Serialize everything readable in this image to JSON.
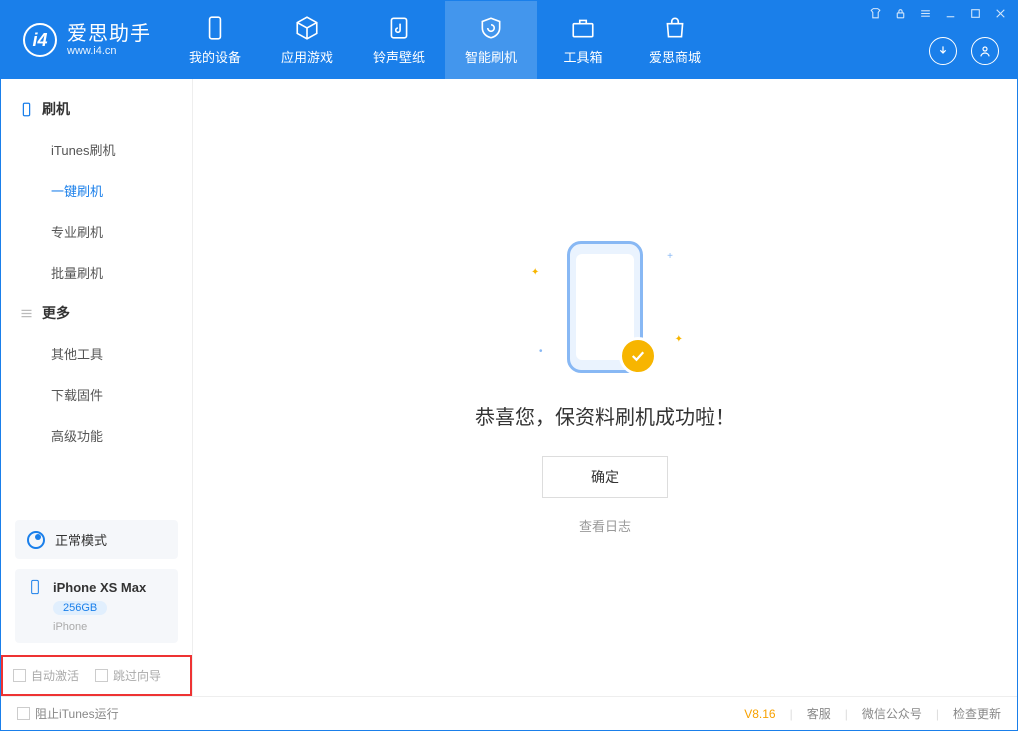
{
  "brand": {
    "name": "爱思助手",
    "url": "www.i4.cn"
  },
  "nav": {
    "my_device": "我的设备",
    "app_games": "应用游戏",
    "ring_wall": "铃声壁纸",
    "smart_flash": "智能刷机",
    "toolbox": "工具箱",
    "store": "爱思商城"
  },
  "sidebar": {
    "group1": {
      "title": "刷机",
      "items": [
        "iTunes刷机",
        "一键刷机",
        "专业刷机",
        "批量刷机"
      ]
    },
    "group2": {
      "title": "更多",
      "items": [
        "其他工具",
        "下载固件",
        "高级功能"
      ]
    },
    "mode_label": "正常模式"
  },
  "device": {
    "name": "iPhone XS Max",
    "storage": "256GB",
    "type": "iPhone"
  },
  "options": {
    "auto_activate": "自动激活",
    "skip_wizard": "跳过向导"
  },
  "main": {
    "message": "恭喜您，保资料刷机成功啦！",
    "ok": "确定",
    "view_log": "查看日志"
  },
  "footer": {
    "block_itunes": "阻止iTunes运行",
    "version": "V8.16",
    "support": "客服",
    "wechat": "微信公众号",
    "check_update": "检查更新"
  }
}
